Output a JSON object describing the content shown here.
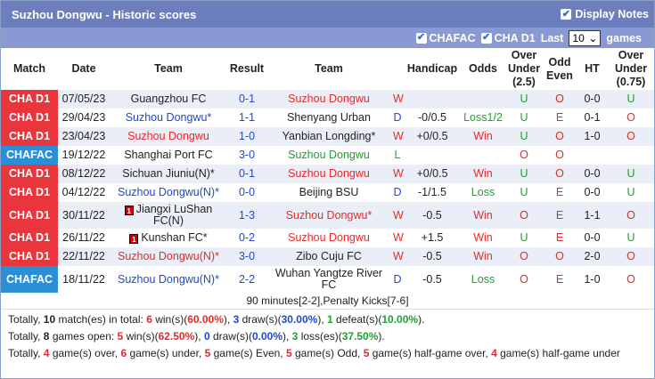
{
  "title": "Suzhou Dongwu - Historic scores",
  "display_notes_label": "Display Notes",
  "filters": {
    "chafac": "CHAFAC",
    "chad1": "CHA D1",
    "last_label": "Last",
    "last_value": "10",
    "games_label": "games"
  },
  "headers": [
    "Match",
    "Date",
    "Team",
    "Result",
    "Team",
    "Handicap",
    "Odds",
    "Over Under (2.5)",
    "Odd Even",
    "HT",
    "Over Under (0.75)"
  ],
  "rows": [
    {
      "league": "CHA D1",
      "date": "07/05/23",
      "home": "Guangzhou FC",
      "result": "0-1",
      "away": "Suzhou Dongwu",
      "wld": "W",
      "hcp": "",
      "odds": "",
      "ou": "U",
      "oe": "O",
      "ht": "0-0",
      "ou2": "U"
    },
    {
      "league": "CHA D1",
      "date": "29/04/23",
      "home": "Suzhou Dongwu*",
      "result": "1-1",
      "away": "Shenyang Urban",
      "wld": "D",
      "hcp": "-0/0.5",
      "odds": "Loss1/2",
      "ou": "U",
      "oe": "E",
      "ht": "0-1",
      "ou2": "O"
    },
    {
      "league": "CHA D1",
      "date": "23/04/23",
      "home": "Suzhou Dongwu",
      "result": "1-0",
      "away": "Yanbian Longding*",
      "wld": "W",
      "hcp": "+0/0.5",
      "odds": "Win",
      "ou": "U",
      "oe": "O",
      "ht": "1-0",
      "ou2": "O"
    },
    {
      "league": "CHAFAC",
      "date": "19/12/22",
      "home": "Shanghai Port FC",
      "result": "3-0",
      "away": "Suzhou Dongwu",
      "wld": "L",
      "hcp": "",
      "odds": "",
      "ou": "O",
      "oe": "O",
      "ht": "",
      "ou2": ""
    },
    {
      "league": "CHA D1",
      "date": "08/12/22",
      "home": "Sichuan Jiuniu(N)*",
      "result": "0-1",
      "away": "Suzhou Dongwu",
      "wld": "W",
      "hcp": "+0/0.5",
      "odds": "Win",
      "ou": "U",
      "oe": "O",
      "ht": "0-0",
      "ou2": "U"
    },
    {
      "league": "CHA D1",
      "date": "04/12/22",
      "home": "Suzhou Dongwu(N)*",
      "result": "0-0",
      "away": "Beijing BSU",
      "wld": "D",
      "hcp": "-1/1.5",
      "odds": "Loss",
      "ou": "U",
      "oe": "E",
      "ht": "0-0",
      "ou2": "U"
    },
    {
      "league": "CHA D1",
      "date": "30/11/22",
      "home": "Jiangxi LuShan FC(N)",
      "home_card": "1",
      "result": "1-3",
      "away": "Suzhou Dongwu*",
      "wld": "W",
      "hcp": "-0.5",
      "odds": "Win",
      "ou": "O",
      "oe": "E",
      "ht": "1-1",
      "ou2": "O"
    },
    {
      "league": "CHA D1",
      "date": "26/11/22",
      "home": "Kunshan FC*",
      "home_card": "1",
      "result": "0-2",
      "away": "Suzhou Dongwu",
      "wld": "W",
      "hcp": "+1.5",
      "odds": "Win",
      "ou": "U",
      "oe": "E",
      "ht": "0-0",
      "ou2": "U"
    },
    {
      "league": "CHA D1",
      "date": "22/11/22",
      "home": "Suzhou Dongwu(N)*",
      "result": "3-0",
      "away": "Zibo Cuju FC",
      "wld": "W",
      "hcp": "-0.5",
      "odds": "Win",
      "ou": "O",
      "oe": "O",
      "ht": "2-0",
      "ou2": "O"
    },
    {
      "league": "CHAFAC",
      "date": "18/11/22",
      "home": "Suzhou Dongwu(N)*",
      "result": "2-2",
      "away": "Wuhan Yangtze River FC",
      "wld": "D",
      "hcp": "-0.5",
      "odds": "Loss",
      "ou": "O",
      "oe": "E",
      "ht": "1-0",
      "ou2": "O"
    }
  ],
  "note": "90 minutes[2-2],Penalty Kicks[7-6]",
  "summary": {
    "l1": {
      "a": "Totally, ",
      "b": "10",
      "c": " match(es) in total: ",
      "d": "6",
      "e": " win(s)(",
      "f": "60.00%",
      "g": "), ",
      "h": "3",
      "i": " draw(s)(",
      "j": "30.00%",
      "k": "), ",
      "l": "1",
      "m": " defeat(s)(",
      "n": "10.00%",
      "o": ")."
    },
    "l2": {
      "a": "Totally, ",
      "b": "8",
      "c": " games open: ",
      "d": "5",
      "e": " win(s)(",
      "f": "62.50%",
      "g": "), ",
      "h": "0",
      "i": " draw(s)(",
      "j": "0.00%",
      "k": "), ",
      "l": "3",
      "m": " loss(es)(",
      "n": "37.50%",
      "o": ")."
    },
    "l3": {
      "a": "Totally, ",
      "b": "4",
      "c": " game(s) over, ",
      "d": "6",
      "e": " game(s) under, ",
      "f": "5",
      "g": " game(s) Even, ",
      "h": "5",
      "i": " game(s) Odd, ",
      "j": "5",
      "k": " game(s) half-game over, ",
      "l": "4",
      "m": " game(s) half-game under"
    }
  },
  "colors": {
    "d1": "#e8363c",
    "fac": "#2a8fd6",
    "win": "#e32b2b",
    "draw": "#1f48d0",
    "loss": "#21a032"
  }
}
